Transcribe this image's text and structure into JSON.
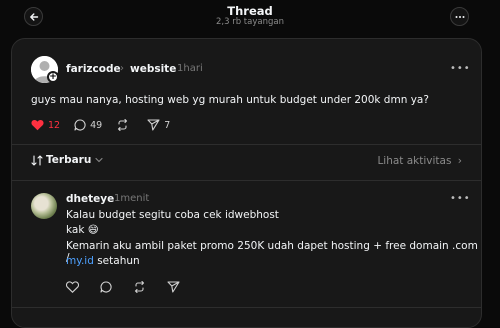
{
  "header": {
    "title": "Thread",
    "views": "2,3 rb tayangan"
  },
  "post": {
    "username": "farizcode",
    "community": "website",
    "time": "1hari",
    "text": "guys mau nanya, hosting web yg murah untuk budget under 200k dmn ya?",
    "likes": "12",
    "replies": "49",
    "shares": "7"
  },
  "sort": {
    "label": "Terbaru",
    "activity_link": "Lihat aktivitas"
  },
  "reply": {
    "username": "dheteye",
    "time": "1menit",
    "line1": "Kalau budget segitu coba cek idwebhost",
    "line2": "kak 😄",
    "line3": "Kemarin aku ambil paket promo 250K udah dapet hosting + free domain .com /",
    "line4_link": "my.id",
    "line4_rest": " setahun"
  },
  "colors": {
    "like": "#ff3040",
    "link": "#4ea1ff",
    "background": "#0a0a0a",
    "panel": "#181818"
  },
  "icons": [
    "back-arrow-icon",
    "more-circle-icon",
    "heart-icon",
    "comment-icon",
    "repost-icon",
    "share-icon",
    "sort-icon",
    "chevron-down-icon",
    "chevron-right-icon",
    "more-icon"
  ]
}
